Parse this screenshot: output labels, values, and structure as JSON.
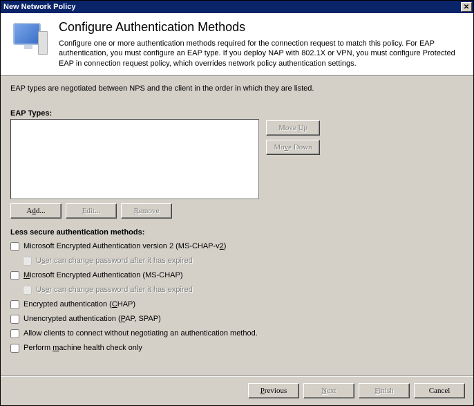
{
  "titlebar": {
    "title": "New Network Policy"
  },
  "header": {
    "heading": "Configure Authentication Methods",
    "desc": "Configure one or more authentication methods required for the connection request to match this policy. For EAP authentication, you must configure an EAP type. If you deploy NAP with 802.1X or VPN, you must configure Protected EAP in connection request policy, which overrides network policy authentication settings."
  },
  "body": {
    "note": "EAP types are negotiated between NPS and the client in the order in which they are listed.",
    "eap_label_pre": "EAP ",
    "eap_label_u": "T",
    "eap_label_post": "ypes:",
    "move_up_pre": "Move ",
    "move_up_u": "U",
    "move_up_post": "p",
    "move_down_pre": "Mo",
    "move_down_u": "v",
    "move_down_post": "e Down",
    "add_pre": "A",
    "add_u": "d",
    "add_post": "d...",
    "edit_pre": "",
    "edit_u": "E",
    "edit_post": "dit...",
    "remove_pre": "",
    "remove_u": "R",
    "remove_post": "emove",
    "less_secure_pre": "",
    "less_secure_u": "L",
    "less_secure_post": "ess secure authentication methods:",
    "chk1_pre": "Microsoft Encrypted Authentication version 2 (MS-CHAP-v",
    "chk1_u": "2",
    "chk1_post": ")",
    "chk1a_pre": "U",
    "chk1a_u": "s",
    "chk1a_post": "er can change password after it has expired",
    "chk2_pre": "",
    "chk2_u": "M",
    "chk2_post": "icrosoft Encrypted Authentication (MS-CHAP)",
    "chk2a_pre": "Us",
    "chk2a_u": "e",
    "chk2a_post": "r can change password after it has expired",
    "chk3_pre": "Encrypted authentication (",
    "chk3_u": "C",
    "chk3_post": "HAP)",
    "chk4_pre": "Unencrypted authentication (",
    "chk4_u": "P",
    "chk4_post": "AP, SPAP)",
    "chk5_pre": "Allow clients to connect without negotiating an authentication ",
    "chk5_u": "",
    "chk5_post": "method.",
    "chk6_pre": "Perform ",
    "chk6_u": "m",
    "chk6_post": "achine health check only"
  },
  "footer": {
    "prev_pre": "",
    "prev_u": "P",
    "prev_post": "revious",
    "next_pre": "",
    "next_u": "N",
    "next_post": "ext",
    "finish_pre": "",
    "finish_u": "F",
    "finish_post": "inish",
    "cancel": "Cancel"
  }
}
